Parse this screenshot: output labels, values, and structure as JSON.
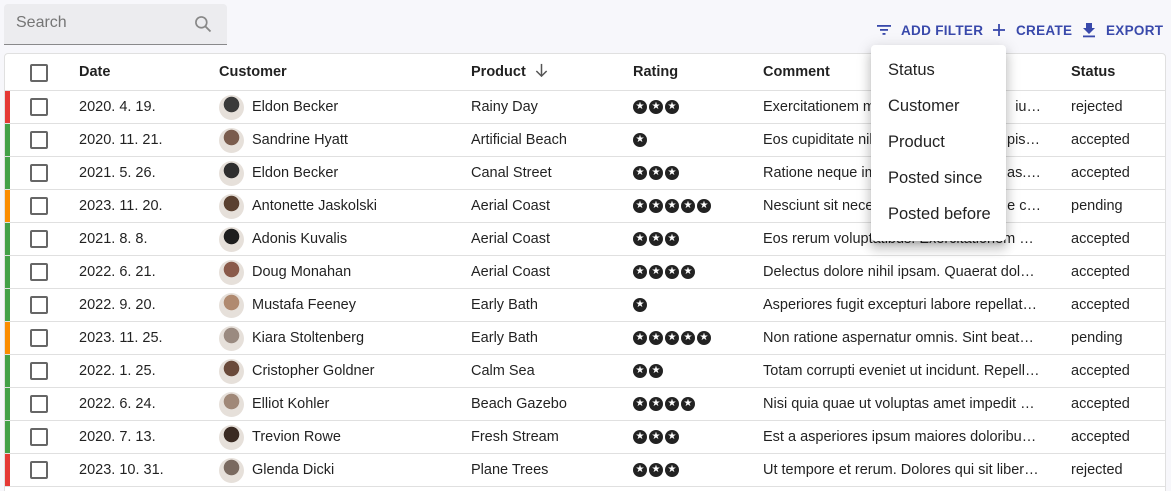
{
  "search": {
    "placeholder": "Search"
  },
  "toolbar": {
    "add_filter": "ADD FILTER",
    "create": "CREATE",
    "export": "EXPORT"
  },
  "colors": {
    "accent": "#3949ab",
    "rejected": "#e53935",
    "accepted": "#43a047",
    "pending": "#fb8c00"
  },
  "table": {
    "headers": {
      "date": "Date",
      "customer": "Customer",
      "product": "Product",
      "rating": "Rating",
      "comment": "Comment",
      "status": "Status"
    },
    "sort": {
      "column": "Product",
      "direction": "desc",
      "icon": "arrow-down-icon"
    },
    "rows": [
      {
        "date": "2020. 4. 19.",
        "customer": "Eldon Becker",
        "product": "Rainy Day",
        "rating": 3,
        "comment": "Exercitationem m",
        "comment_end": "iu…",
        "status": "rejected"
      },
      {
        "date": "2020. 11. 21.",
        "customer": "Sandrine Hyatt",
        "product": "Artificial Beach",
        "rating": 1,
        "comment": "Eos cupiditate nil",
        "comment_end": "pisc…",
        "status": "accepted"
      },
      {
        "date": "2021. 5. 26.",
        "customer": "Eldon Becker",
        "product": "Canal Street",
        "rating": 3,
        "comment": "Ratione neque im",
        "comment_end": "as. …",
        "status": "accepted"
      },
      {
        "date": "2023. 11. 20.",
        "customer": "Antonette Jaskolski",
        "product": "Aerial Coast",
        "rating": 5,
        "comment": "Nesciunt sit nece",
        "comment_end": "e c…",
        "status": "pending"
      },
      {
        "date": "2021. 8. 8.",
        "customer": "Adonis Kuvalis",
        "product": "Aerial Coast",
        "rating": 3,
        "comment": "Eos rerum voluptatibus. Exercitationem v…",
        "comment_end": "",
        "status": "accepted"
      },
      {
        "date": "2022. 6. 21.",
        "customer": "Doug Monahan",
        "product": "Aerial Coast",
        "rating": 4,
        "comment": "Delectus dolore nihil ipsam. Quaerat dolor…",
        "comment_end": "",
        "status": "accepted"
      },
      {
        "date": "2022. 9. 20.",
        "customer": "Mustafa Feeney",
        "product": "Early Bath",
        "rating": 1,
        "comment": "Asperiores fugit excepturi labore repellat …",
        "comment_end": "",
        "status": "accepted"
      },
      {
        "date": "2023. 11. 25.",
        "customer": "Kiara Stoltenberg",
        "product": "Early Bath",
        "rating": 5,
        "comment": "Non ratione aspernatur omnis. Sint beata…",
        "comment_end": "",
        "status": "pending"
      },
      {
        "date": "2022. 1. 25.",
        "customer": "Cristopher Goldner",
        "product": "Calm Sea",
        "rating": 2,
        "comment": "Totam corrupti eveniet ut incidunt. Repell…",
        "comment_end": "",
        "status": "accepted"
      },
      {
        "date": "2022. 6. 24.",
        "customer": "Elliot Kohler",
        "product": "Beach Gazebo",
        "rating": 4,
        "comment": "Nisi quia quae ut voluptas amet impedit a…",
        "comment_end": "",
        "status": "accepted"
      },
      {
        "date": "2020. 7. 13.",
        "customer": "Trevion Rowe",
        "product": "Fresh Stream",
        "rating": 3,
        "comment": "Est a asperiores ipsum maiores doloribus…",
        "comment_end": "",
        "status": "accepted"
      },
      {
        "date": "2023. 10. 31.",
        "customer": "Glenda Dicki",
        "product": "Plane Trees",
        "rating": 3,
        "comment": "Ut tempore et rerum. Dolores qui sit libero…",
        "comment_end": "",
        "status": "rejected"
      }
    ]
  },
  "filter_menu": {
    "items": [
      "Status",
      "Customer",
      "Product",
      "Posted since",
      "Posted before"
    ]
  }
}
